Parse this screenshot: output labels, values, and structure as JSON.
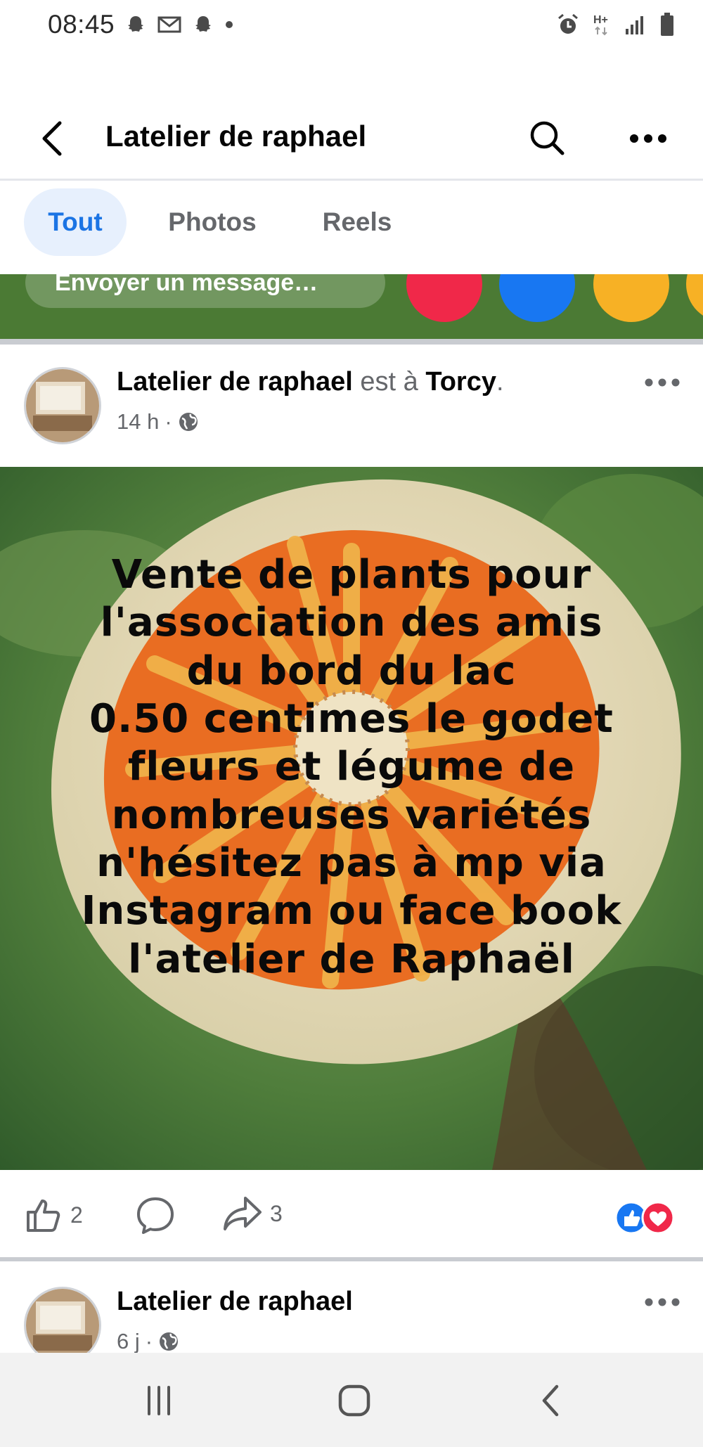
{
  "status_bar": {
    "time": "08:45",
    "left_icons": [
      "snapchat-icon",
      "gmail-icon",
      "snapchat-icon",
      "dot-icon"
    ],
    "right_icons": [
      "alarm-icon",
      "network-h-plus-icon",
      "signal-icon",
      "battery-icon"
    ],
    "network_label": "H+"
  },
  "header": {
    "title": "Latelier de raphael",
    "back_icon": "back-arrow-icon",
    "search_icon": "search-icon",
    "more_icon": "more-horizontal-icon"
  },
  "tabs": [
    {
      "label": "Tout",
      "selected": true
    },
    {
      "label": "Photos",
      "selected": false
    },
    {
      "label": "Reels",
      "selected": false
    }
  ],
  "reaction_strip": {
    "message_placeholder": "Envoyer un message…",
    "reactions": [
      "love-reaction",
      "like-reaction",
      "haha-reaction",
      "more-reaction"
    ]
  },
  "post": {
    "author": "Latelier de raphael",
    "location_prefix": "est à",
    "location": "Torcy",
    "location_suffix": ".",
    "time": "14 h",
    "separator": "·",
    "audience_icon": "globe-icon",
    "caption": "Vente de plants pour\nl'association des amis\ndu bord du lac\n0.50 centimes le godet\nfleurs et légume de\nnombreuses variétés\nn'hésitez pas à mp via\nInstagram ou face book\nl'atelier de Raphaël",
    "likes": "2",
    "shares": "3",
    "reaction_icons": [
      "like-reaction",
      "love-reaction"
    ],
    "colors": {
      "like_blue": "#1877f2",
      "love_red": "#f02849"
    }
  },
  "next_post": {
    "author": "Latelier de raphael",
    "time": "6 j",
    "separator": "·"
  },
  "nav_bar": {
    "buttons": [
      "recent-apps-icon",
      "home-icon",
      "back-icon"
    ]
  },
  "theme": {
    "accent": "#1b74e4",
    "tab_selected_bg": "#e7f0fd",
    "secondary_text": "#65676b",
    "divider": "#c9ccd1"
  }
}
